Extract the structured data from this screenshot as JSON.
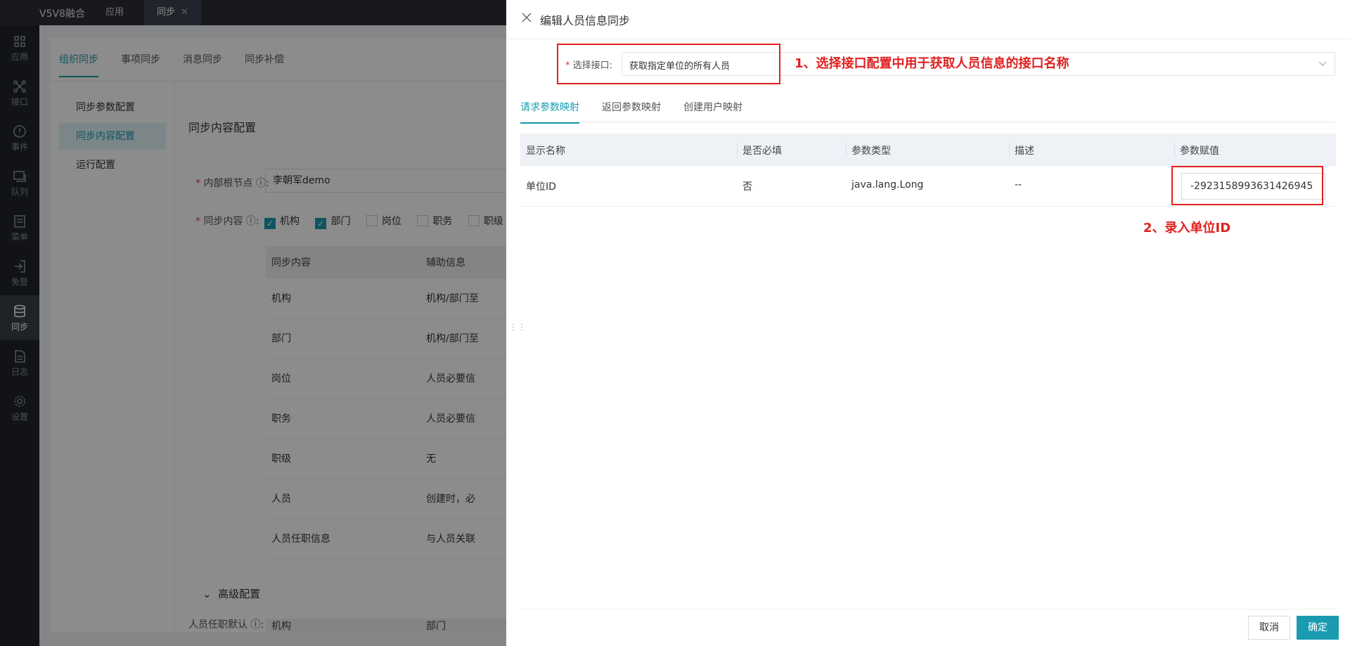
{
  "topbar": {
    "brand": "V5V8融合",
    "tabs": [
      {
        "label": "应用"
      },
      {
        "label": "同步",
        "close": "✕"
      }
    ]
  },
  "rail": [
    {
      "label": "应用",
      "icon": "apps-icon"
    },
    {
      "label": "接口",
      "icon": "connect-icon"
    },
    {
      "label": "事件",
      "icon": "alert-icon"
    },
    {
      "label": "队列",
      "icon": "queue-icon"
    },
    {
      "label": "菜单",
      "icon": "menu-icon"
    },
    {
      "label": "免登",
      "icon": "login-icon"
    },
    {
      "label": "同步",
      "icon": "database-icon"
    },
    {
      "label": "日志",
      "icon": "log-icon"
    },
    {
      "label": "设置",
      "icon": "gear-icon"
    }
  ],
  "background": {
    "sub_tabs": [
      "组织同步",
      "事项同步",
      "消息同步",
      "同步补偿"
    ],
    "left_nav": [
      "同步参数配置",
      "同步内容配置",
      "运行配置"
    ],
    "section_title": "同步内容配置",
    "root_label": "内部根节点",
    "root_value": "李朝军demo",
    "content_label": "同步内容",
    "checkboxes": [
      {
        "label": "机构",
        "checked": true
      },
      {
        "label": "部门",
        "checked": true
      },
      {
        "label": "岗位",
        "checked": false
      },
      {
        "label": "职务",
        "checked": false
      },
      {
        "label": "职级",
        "checked": false
      }
    ],
    "table_headers": [
      "同步内容",
      "辅助信息"
    ],
    "table_rows": [
      [
        "机构",
        "机构/部门至"
      ],
      [
        "部门",
        "机构/部门至"
      ],
      [
        "岗位",
        "人员必要信"
      ],
      [
        "职务",
        "人员必要信"
      ],
      [
        "职级",
        "无"
      ],
      [
        "人员",
        "创建时，必"
      ],
      [
        "人员任职信息",
        "与人员关联"
      ]
    ],
    "advanced_title": "高级配置",
    "advanced_label": "人员任职默认",
    "advanced_headers": [
      "机构",
      "部门"
    ]
  },
  "drawer": {
    "title": "编辑人员信息同步",
    "iface_label": "选择接口:",
    "iface_value": "获取指定单位的所有人员",
    "annot1": "1、选择接口配置中用于获取人员信息的接口名称",
    "tabs": [
      "请求参数映射",
      "返回参数映射",
      "创建用户映射"
    ],
    "table_headers": [
      "显示名称",
      "是否必填",
      "参数类型",
      "描述",
      "参数赋值"
    ],
    "rows": [
      {
        "name": "单位ID",
        "required": "否",
        "type": "java.lang.Long",
        "desc": "--",
        "value": "-2923158993631426945"
      }
    ],
    "annot2": "2、录入单位ID",
    "cancel": "取消",
    "ok": "确定"
  },
  "colors": {
    "accent": "#1a9bb0",
    "annotation": "#e02020"
  }
}
